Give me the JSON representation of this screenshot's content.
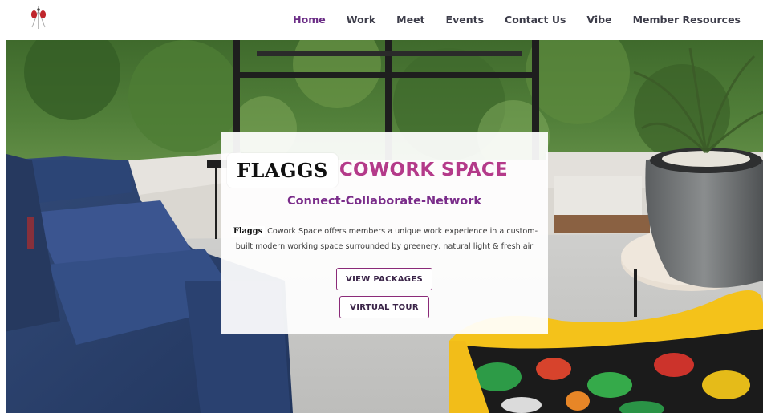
{
  "nav": {
    "items": [
      {
        "label": "Home",
        "active": true
      },
      {
        "label": "Work",
        "active": false
      },
      {
        "label": "Meet",
        "active": false
      },
      {
        "label": "Events",
        "active": false
      },
      {
        "label": "Contact Us",
        "active": false
      },
      {
        "label": "Vibe",
        "active": false
      },
      {
        "label": "Member Resources",
        "active": false
      }
    ]
  },
  "hero": {
    "brand_name": "FLAGGS",
    "brand_suffix": "COWORK SPACE",
    "tagline": "Connect-Collaborate-Network",
    "description_brand": "Flaggs",
    "description_line1": " Cowork Space offers members a unique work experience in a custom-",
    "description_line2": "built modern working space surrounded by greenery, natural light & fresh air",
    "primary_button": "VIEW PACKAGES",
    "secondary_button": "VIRTUAL TOUR"
  },
  "colors": {
    "accent": "#6b2d86",
    "brand_pink": "#b43a8a",
    "button_border": "#8a2a78"
  }
}
